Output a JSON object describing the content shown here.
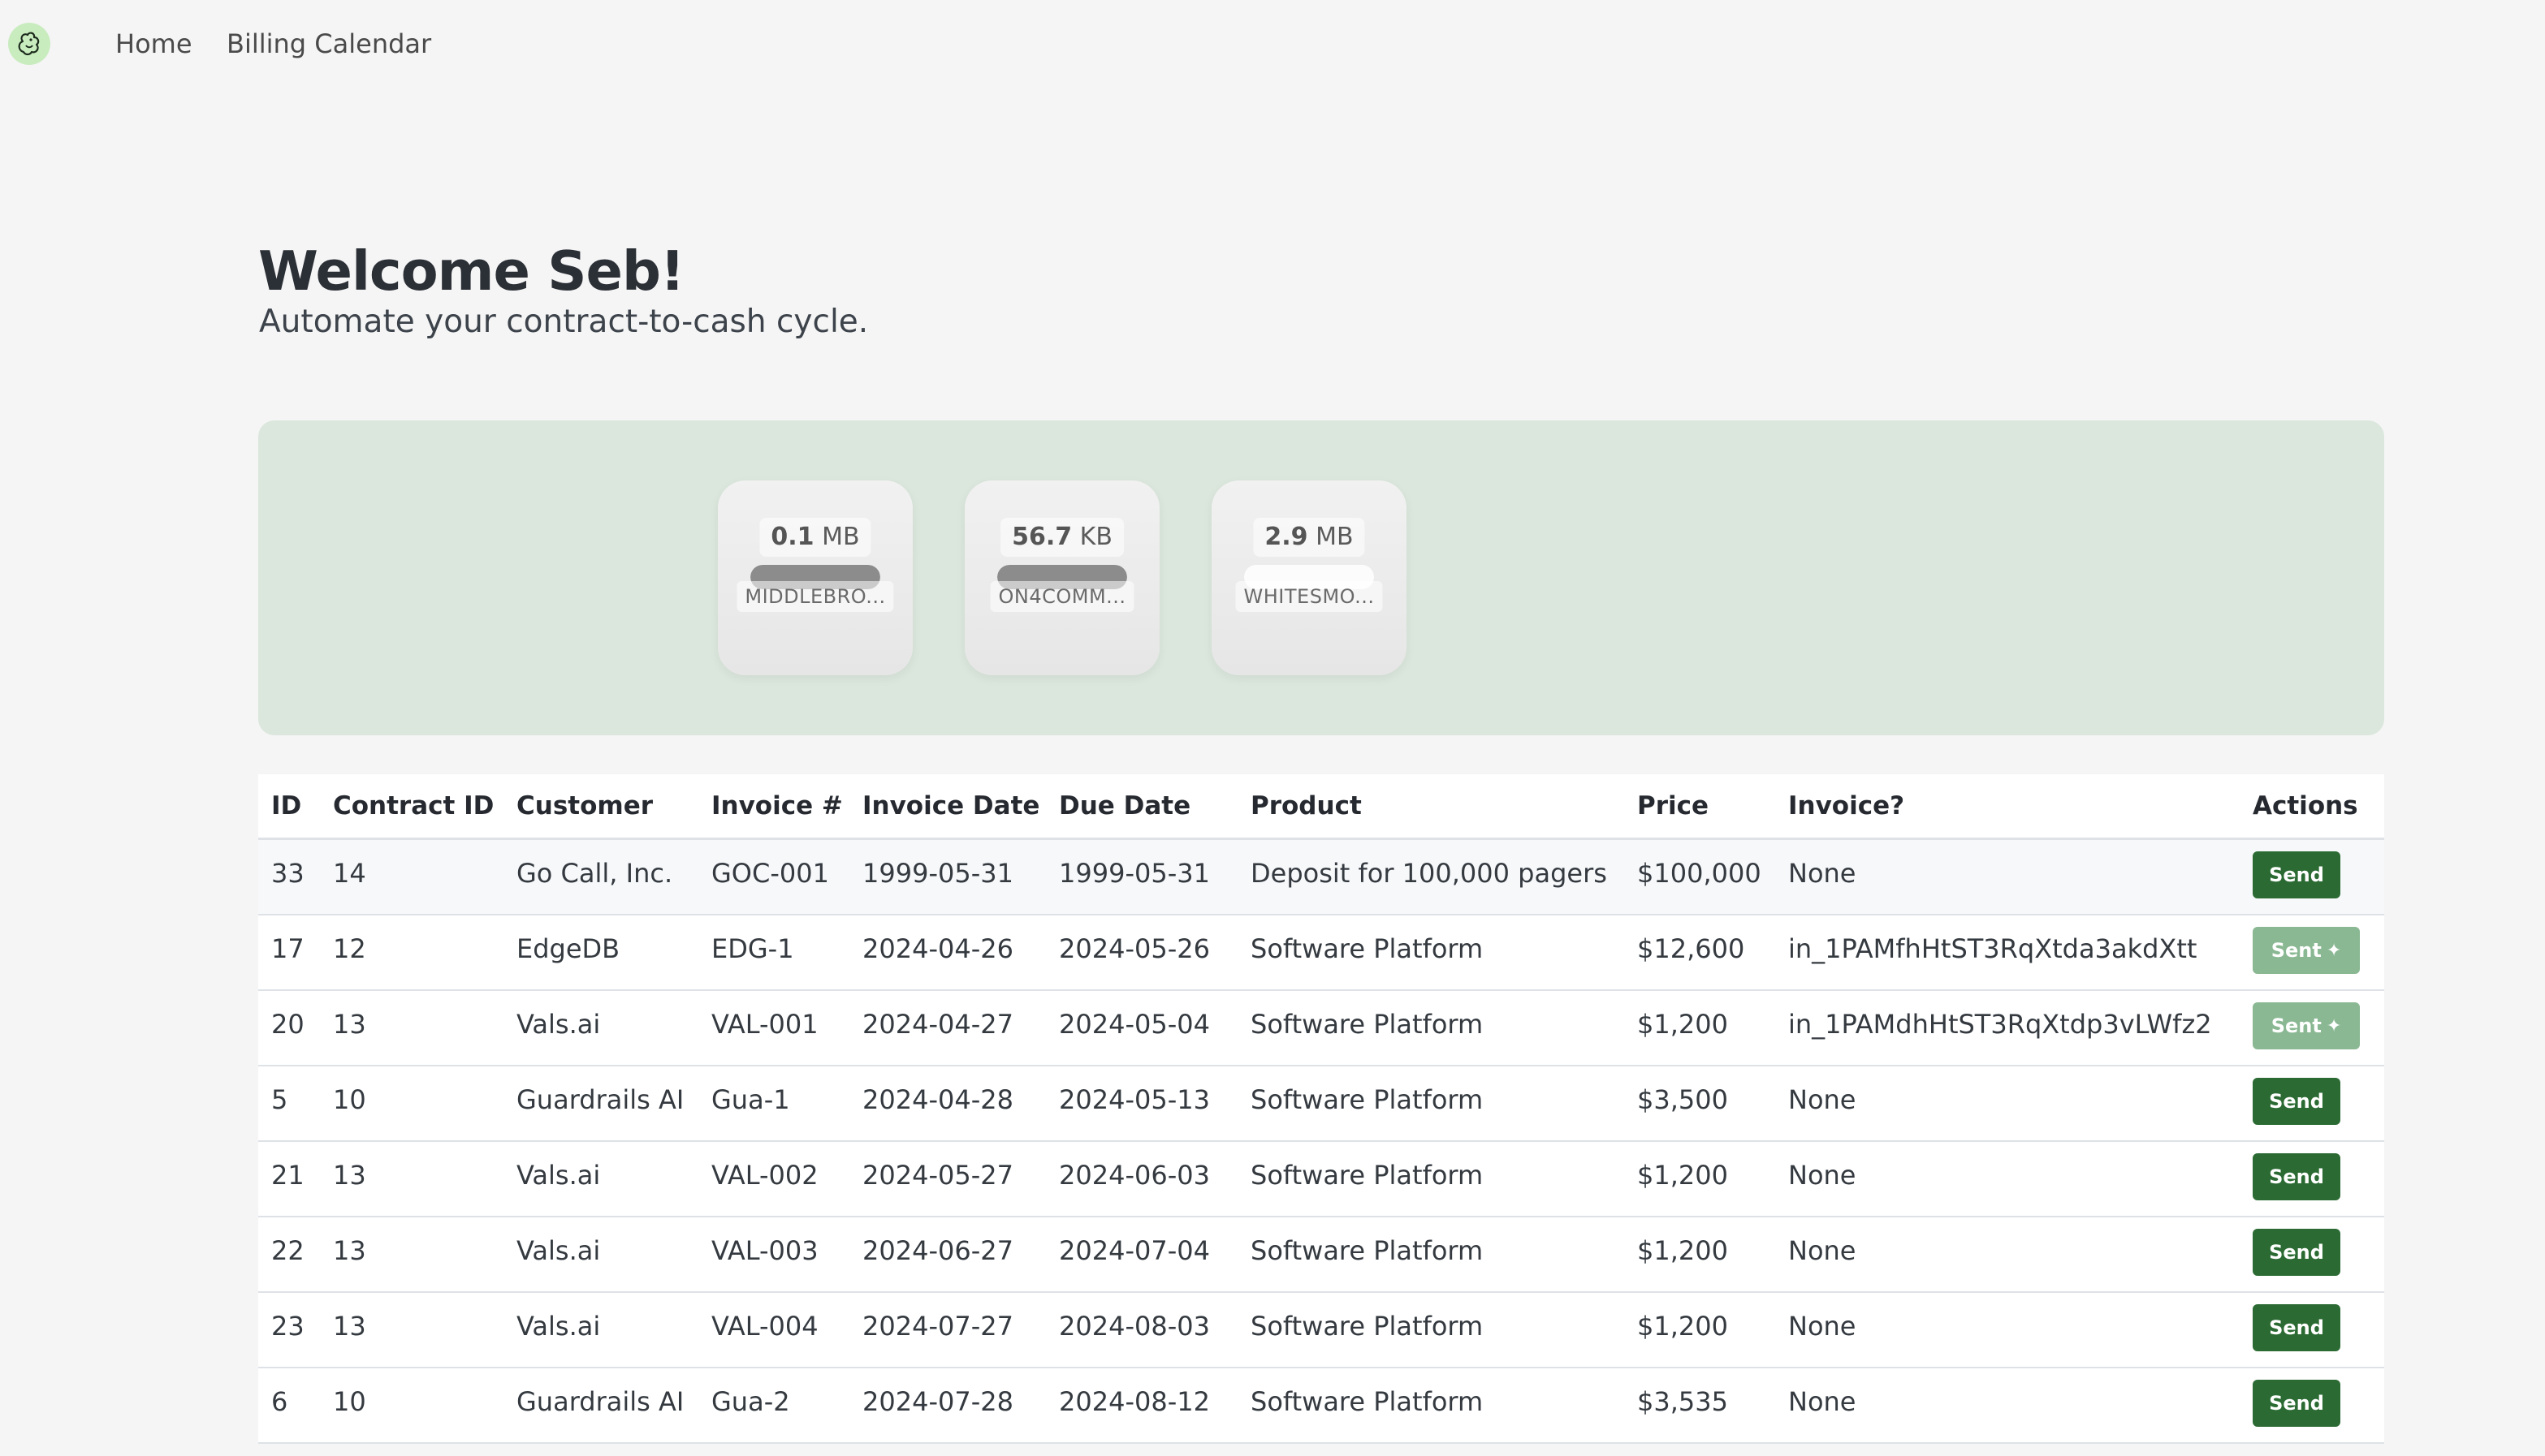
{
  "nav": {
    "logo_icon": "squirrel-logo-icon",
    "home": "Home",
    "billing_calendar": "Billing Calendar"
  },
  "header": {
    "title": "Welcome Seb!",
    "subtitle": "Automate your contract-to-cash cycle."
  },
  "uploads": [
    {
      "size_value": "0.1",
      "size_unit": "MB",
      "name": "MIDDLEBRO...",
      "progress": 1.0
    },
    {
      "size_value": "56.7",
      "size_unit": "KB",
      "name": "ON4COMM...",
      "progress": 1.0
    },
    {
      "size_value": "2.9",
      "size_unit": "MB",
      "name": "WHITESMO...",
      "progress": 0.0
    }
  ],
  "table": {
    "headers": [
      "ID",
      "Contract ID",
      "Customer",
      "Invoice #",
      "Invoice Date",
      "Due Date",
      "Product",
      "Price",
      "Invoice?",
      "Actions"
    ],
    "rows": [
      {
        "id": "33",
        "contract_id": "14",
        "customer": "Go Call, Inc.",
        "invoice_no": "GOC-001",
        "invoice_date": "1999-05-31",
        "due_date": "1999-05-31",
        "product": "Deposit for 100,000 pagers",
        "price": "$100,000",
        "invoice": "None",
        "action": "Send",
        "sent": false
      },
      {
        "id": "17",
        "contract_id": "12",
        "customer": "EdgeDB",
        "invoice_no": "EDG-1",
        "invoice_date": "2024-04-26",
        "due_date": "2024-05-26",
        "product": "Software Platform",
        "price": "$12,600",
        "invoice": "in_1PAMfhHtST3RqXtda3akdXtt",
        "action": "Sent",
        "sent": true
      },
      {
        "id": "20",
        "contract_id": "13",
        "customer": "Vals.ai",
        "invoice_no": "VAL-001",
        "invoice_date": "2024-04-27",
        "due_date": "2024-05-04",
        "product": "Software Platform",
        "price": "$1,200",
        "invoice": "in_1PAMdhHtST3RqXtdp3vLWfz2",
        "action": "Sent",
        "sent": true
      },
      {
        "id": "5",
        "contract_id": "10",
        "customer": "Guardrails AI",
        "invoice_no": "Gua-1",
        "invoice_date": "2024-04-28",
        "due_date": "2024-05-13",
        "product": "Software Platform",
        "price": "$3,500",
        "invoice": "None",
        "action": "Send",
        "sent": false
      },
      {
        "id": "21",
        "contract_id": "13",
        "customer": "Vals.ai",
        "invoice_no": "VAL-002",
        "invoice_date": "2024-05-27",
        "due_date": "2024-06-03",
        "product": "Software Platform",
        "price": "$1,200",
        "invoice": "None",
        "action": "Send",
        "sent": false
      },
      {
        "id": "22",
        "contract_id": "13",
        "customer": "Vals.ai",
        "invoice_no": "VAL-003",
        "invoice_date": "2024-06-27",
        "due_date": "2024-07-04",
        "product": "Software Platform",
        "price": "$1,200",
        "invoice": "None",
        "action": "Send",
        "sent": false
      },
      {
        "id": "23",
        "contract_id": "13",
        "customer": "Vals.ai",
        "invoice_no": "VAL-004",
        "invoice_date": "2024-07-27",
        "due_date": "2024-08-03",
        "product": "Software Platform",
        "price": "$1,200",
        "invoice": "None",
        "action": "Send",
        "sent": false
      },
      {
        "id": "6",
        "contract_id": "10",
        "customer": "Guardrails AI",
        "invoice_no": "Gua-2",
        "invoice_date": "2024-07-28",
        "due_date": "2024-08-12",
        "product": "Software Platform",
        "price": "$3,535",
        "invoice": "None",
        "action": "Send",
        "sent": false
      }
    ]
  },
  "colors": {
    "send_button": "#2b6b33",
    "sent_button": "#8ab893",
    "dropzone_bg": "#dbe7dd",
    "logo_bg": "#c9ecbf"
  }
}
